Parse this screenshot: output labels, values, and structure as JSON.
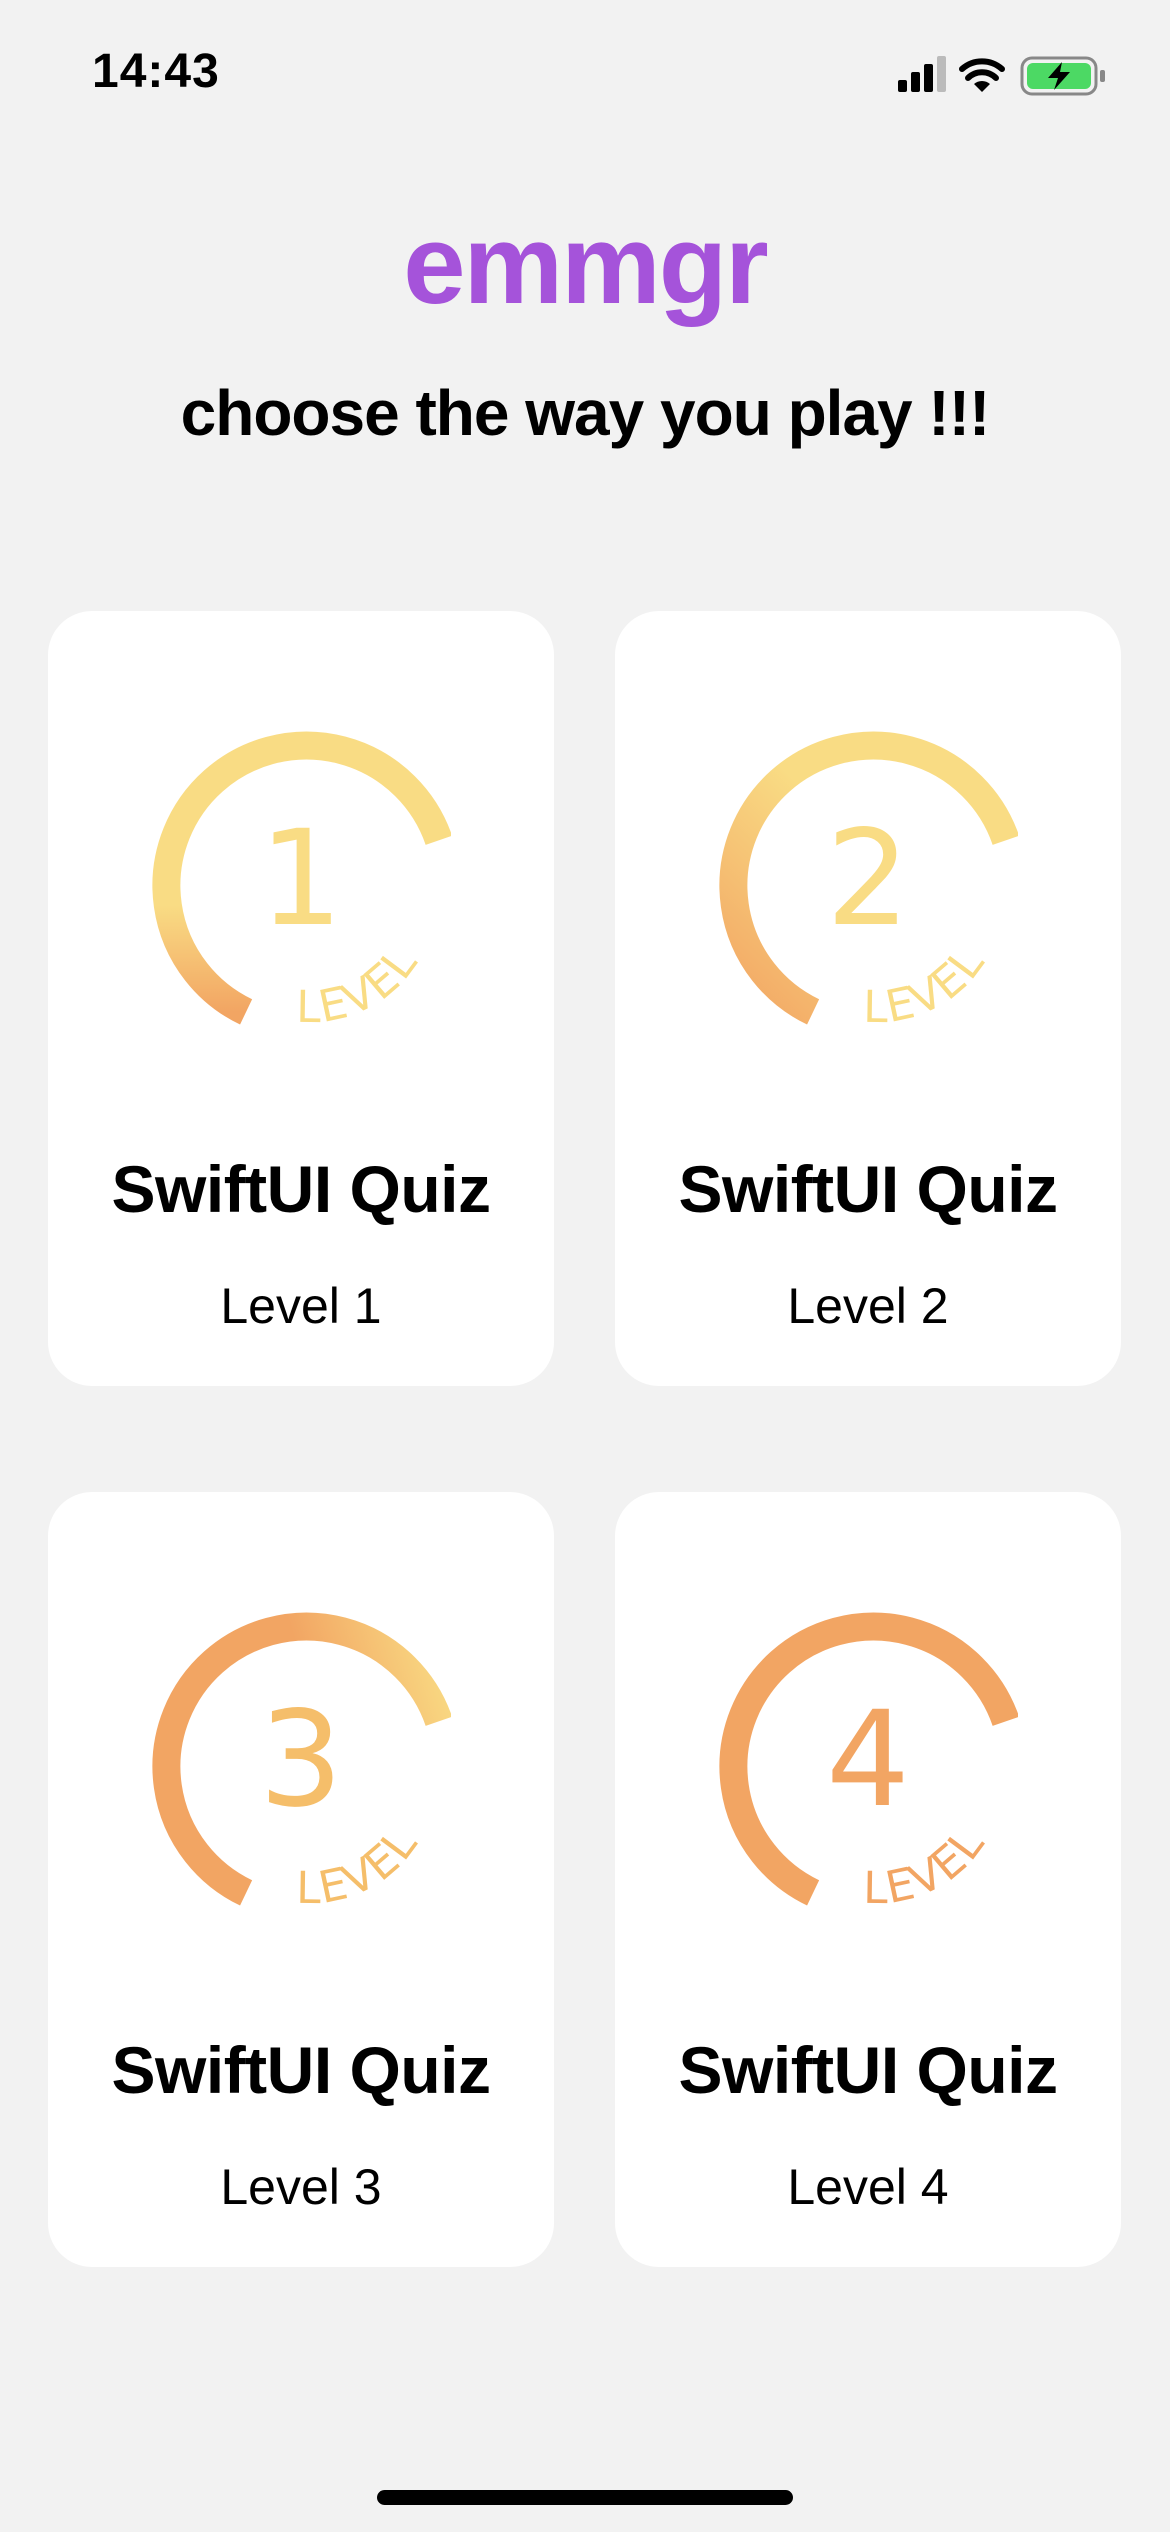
{
  "status_bar": {
    "time": "14:43",
    "icons": [
      "cellular-signal-icon",
      "wifi-icon",
      "battery-charging-icon"
    ]
  },
  "header": {
    "title": "emmgr",
    "subtitle": "choose the way you play !!!"
  },
  "colors": {
    "title_purple": "#a553da",
    "badge_yellow": "#f9dc84",
    "badge_orange": "#f2a563",
    "background": "#f2f2f2",
    "card": "#ffffff"
  },
  "cards": [
    {
      "badge_number": "1",
      "badge_text": "LEVEL",
      "title": "SwiftUI Quiz",
      "level_label": "Level 1",
      "icon": "level-1-badge-icon"
    },
    {
      "badge_number": "2",
      "badge_text": "LEVEL",
      "title": "SwiftUI Quiz",
      "level_label": "Level 2",
      "icon": "level-2-badge-icon"
    },
    {
      "badge_number": "3",
      "badge_text": "LEVEL",
      "title": "SwiftUI Quiz",
      "level_label": "Level 3",
      "icon": "level-3-badge-icon"
    },
    {
      "badge_number": "4",
      "badge_text": "LEVEL",
      "title": "SwiftUI Quiz",
      "level_label": "Level 4",
      "icon": "level-4-badge-icon"
    }
  ]
}
